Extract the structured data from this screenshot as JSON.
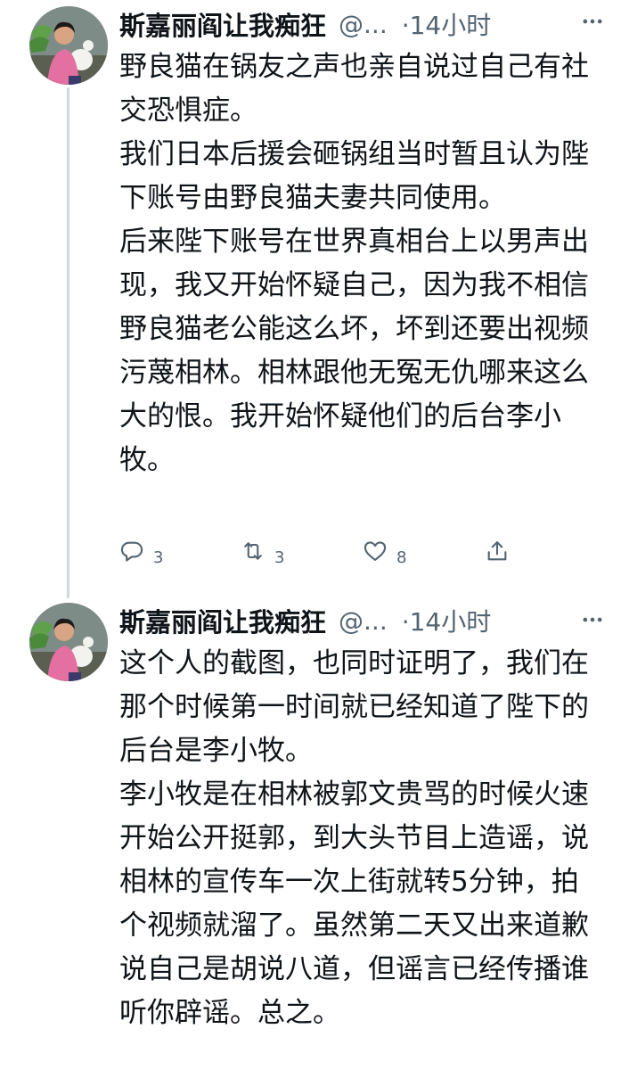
{
  "tweets": [
    {
      "author_name": "斯嘉丽阎让我痴狂",
      "handle": "@...",
      "time": "·14小时",
      "paragraphs": [
        "野良猫在锅友之声也亲自说过自己有社交恐惧症。",
        "我们日本后援会砸锅组当时暂且认为陛下账号由野良猫夫妻共同使用。",
        "后来陛下账号在世界真相台上以男声出现，我又开始怀疑自己，因为我不相信野良猫老公能这么坏，坏到还要出视频污蔑相林。相林跟他无冤无仇哪来这么大的恨。我开始怀疑他们的后台李小牧。"
      ],
      "actions": {
        "reply_count": "3",
        "retweet_count": "3",
        "like_count": "8"
      }
    },
    {
      "author_name": "斯嘉丽阎让我痴狂",
      "handle": "@...",
      "time": "·14小时",
      "paragraphs": [
        "这个人的截图，也同时证明了，我们在那个时候第一时间就已经知道了陛下的后台是李小牧。",
        "李小牧是在相林被郭文贵骂的时候火速开始公开挺郭，到大头节目上造谣，说相林的宣传车一次上街就转5分钟，拍个视频就溜了。虽然第二天又出来道歉说自己是胡说八道，但谣言已经传播谁听你辟谣。总之。"
      ]
    }
  ],
  "icons": {
    "reply": "reply-icon",
    "retweet": "retweet-icon",
    "like": "heart-icon",
    "share": "share-icon",
    "more": "more-options-icon"
  },
  "colors": {
    "text": "#0f1419",
    "secondary": "#536471",
    "thread_line": "#cfd9de",
    "background": "#ffffff"
  }
}
